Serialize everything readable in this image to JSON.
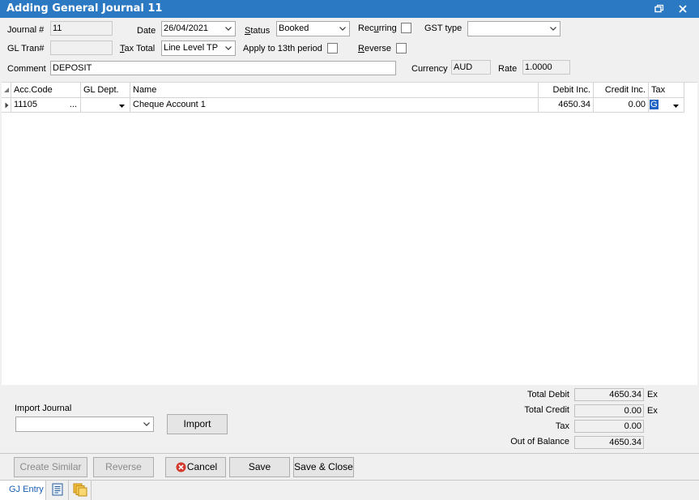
{
  "window": {
    "title": "Adding General Journal 11",
    "restore_glyph": "⧉",
    "close_glyph": "✕"
  },
  "header": {
    "journal_label": "Journal #",
    "journal_value": "11",
    "gltran_label": "GL Tran#",
    "gltran_value": "",
    "comment_label": "Comment",
    "comment_value": "DEPOSIT",
    "date_label": "Date",
    "date_value": "26/04/2021",
    "taxtotal_label": "Tax Total",
    "taxtotal_value": "Line Level TP",
    "status_label": "Status",
    "status_value": "Booked",
    "apply13_label": "Apply to 13th period",
    "recurring_label": "Recurring",
    "reverse_label": "Reverse",
    "gsttype_label": "GST type",
    "gsttype_value": "",
    "currency_label": "Currency",
    "currency_value": "AUD",
    "rate_label": "Rate",
    "rate_value": "1.0000"
  },
  "grid": {
    "columns": [
      "Acc.Code",
      "GL Dept.",
      "Name",
      "Debit Inc.",
      "Credit Inc.",
      "Tax"
    ],
    "rows": [
      {
        "acc_code": "11105",
        "ellipsis": "...",
        "gl_dept": "",
        "name": "Cheque Account 1",
        "debit": "4650.34",
        "credit": "0.00",
        "tax": "G"
      }
    ]
  },
  "import": {
    "label": "Import Journal",
    "value": "",
    "button": "Import"
  },
  "totals": {
    "total_debit_label": "Total Debit",
    "total_debit": "4650.34",
    "total_debit_suffix": "Ex",
    "total_credit_label": "Total Credit",
    "total_credit": "0.00",
    "total_credit_suffix": "Ex",
    "tax_label": "Tax",
    "tax": "0.00",
    "oob_label": "Out of Balance",
    "oob": "4650.34"
  },
  "buttons": {
    "create_similar": "Create Similar",
    "reverse": "Reverse",
    "cancel": "Cancel",
    "save": "Save",
    "save_close": "Save & Close"
  },
  "tabs": {
    "gj_entry": "GJ Entry"
  },
  "colors": {
    "titlebar": "#2b79c2",
    "tab_text": "#1a5fb4",
    "cancel_icon": "#d23a2e",
    "selection": "#1c63c5"
  }
}
